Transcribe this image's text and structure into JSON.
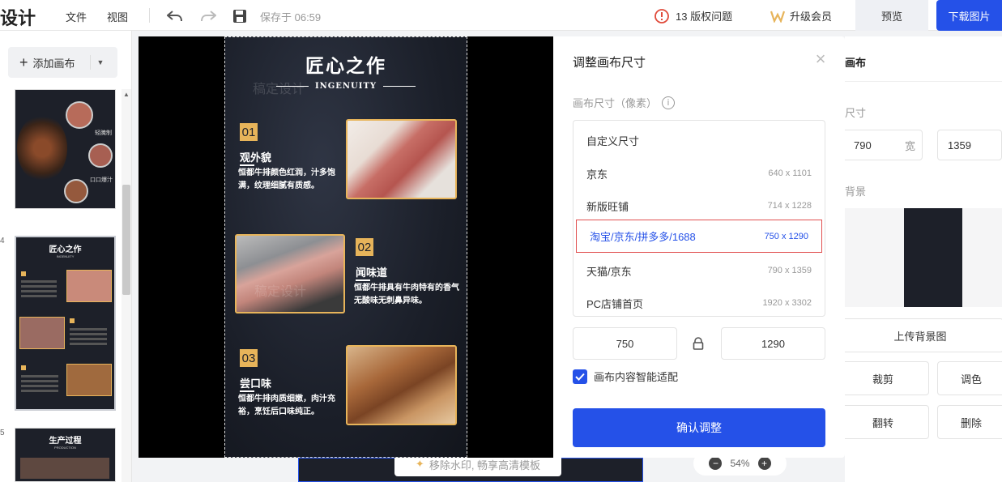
{
  "topbar": {
    "logo": "设计",
    "menu_file": "文件",
    "menu_view": "视图",
    "saved": "保存于 06:59",
    "issues": "13 版权问题",
    "vip": "升级会员",
    "preview": "预览",
    "download": "下载图片"
  },
  "left": {
    "add_canvas": "添加画布",
    "page_no_4": "4",
    "page_no_5": "5"
  },
  "thumb1": {
    "tag1": "轻腌制",
    "tag2": "口口爆汁"
  },
  "thumb2": {
    "title": "匠心之作",
    "sub": "INGENUITY"
  },
  "thumb3": {
    "title": "生产过程",
    "sub": "PRODUCTION"
  },
  "poster": {
    "title": "匠心之作",
    "subtitle": "INGENUITY",
    "watermark": "稿定设计",
    "sections": [
      {
        "num": "01",
        "title": "观外貌",
        "desc": "恒都牛排颜色红润，汁多饱满，纹理细腻有质感。"
      },
      {
        "num": "02",
        "title": "闻味道",
        "desc": "恒都牛排具有牛肉特有的香气无酸味无刺鼻异味。"
      },
      {
        "num": "03",
        "title": "尝口味",
        "desc": "恒都牛排肉质细嫩，肉汁充裕，烹饪后口味纯正。"
      }
    ]
  },
  "bottom": {
    "watermark_pill": "移除水印, 畅享高清模板",
    "zoom": "54%"
  },
  "right": {
    "heading": "画布",
    "size_label": "尺寸",
    "width": "790",
    "wide": "宽",
    "height": "1359",
    "bg_label": "背景",
    "upload_bg": "上传背景图",
    "crop": "裁剪",
    "tone": "调色",
    "flip": "翻转",
    "delete": "删除"
  },
  "modal": {
    "title": "调整画布尺寸",
    "close": "×",
    "size_label": "画布尺寸（像素）",
    "info": "i",
    "options": [
      {
        "name": "自定义尺寸",
        "dim": ""
      },
      {
        "name": "京东",
        "dim": "640 x 1101"
      },
      {
        "name": "新版旺铺",
        "dim": "714 x 1228"
      },
      {
        "name": "淘宝/京东/拼多多/1688",
        "dim": "750 x 1290"
      },
      {
        "name": "天猫/京东",
        "dim": "790 x 1359"
      },
      {
        "name": "PC店铺首页",
        "dim": "1920 x 3302"
      }
    ],
    "width_value": "750",
    "height_value": "1290",
    "smart_fit": "画布内容智能适配",
    "confirm": "确认调整"
  },
  "colors": {
    "accent": "#2551e8",
    "gold": "#e7b45a",
    "selected_border": "#e15050"
  }
}
